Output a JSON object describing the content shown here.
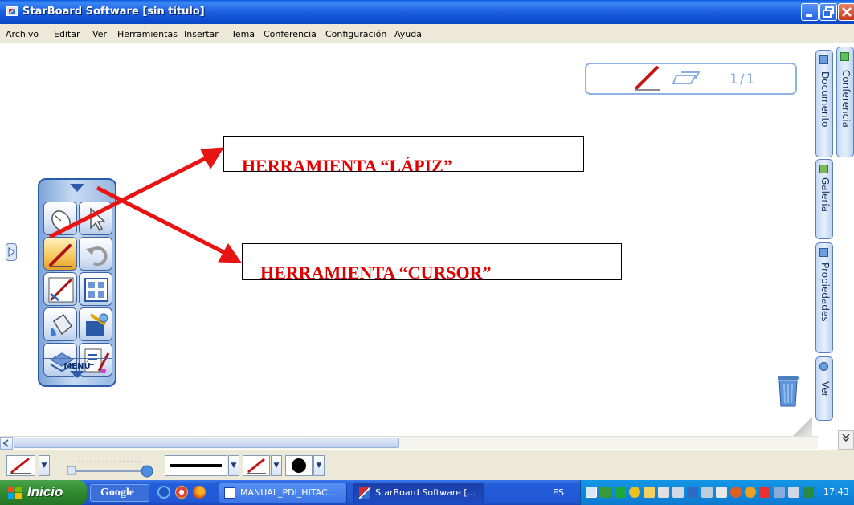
{
  "window": {
    "title": "StarBoard Software [sin título]",
    "buttons": [
      "minimize",
      "restore",
      "close"
    ]
  },
  "menu": [
    "Archivo",
    "Editar",
    "Ver",
    "Herramientas",
    "Insertar",
    "Tema",
    "Conferencia",
    "Configuración",
    "Ayuda"
  ],
  "page_indicator": "1/1",
  "annotations": {
    "lapiz": "HERRAMIENTA  “LÁPIZ”",
    "cursor": "HERRAMIENTA “CURSOR”"
  },
  "toolbar": {
    "menu_label": "MENÚ",
    "tools": [
      "mouse-icon",
      "cursor-arrow-icon",
      "pen-icon",
      "undo-icon",
      "pen-eraser-icon",
      "layout-icon",
      "paint-bucket-icon",
      "tools-gear-icon",
      "layers-icon",
      "settings-edit-icon"
    ],
    "selected_tool": "pen-icon"
  },
  "side_tabs": [
    "Documento",
    "Conferencia",
    "Galería",
    "Propiedades",
    "Ver"
  ],
  "bottom_toolbar": {
    "icons": [
      "pen-icon",
      "line-width-slider",
      "line-style",
      "pen-color",
      "dot-size"
    ]
  },
  "taskbar": {
    "start": "Inicio",
    "google": "Google",
    "tasks": [
      "MANUAL_PDI_HITAC...",
      "StarBoard Software [..."
    ],
    "language": "ES",
    "clock": "17:43"
  },
  "colors": {
    "annotation": "#e00000",
    "title_bar": "#1f63e0",
    "taskbar": "#245edb",
    "start": "#2e8a2e"
  }
}
